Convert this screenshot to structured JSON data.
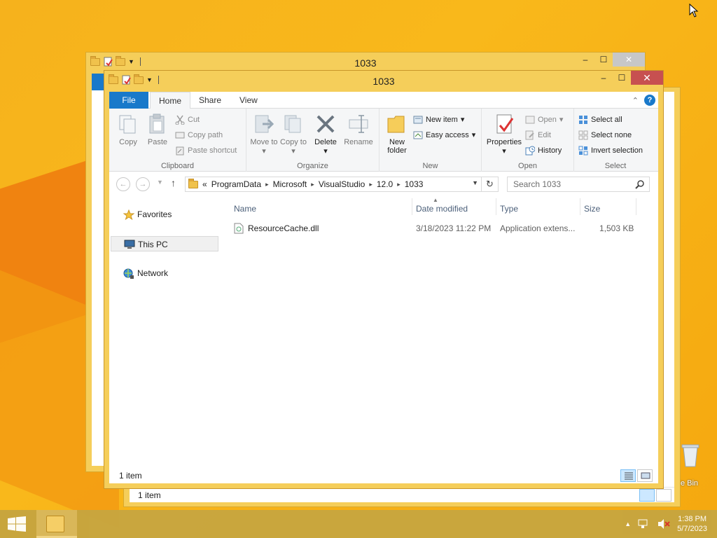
{
  "desktop": {
    "recycle_bin_label": "cle Bin"
  },
  "back_window": {
    "title": "1033"
  },
  "right_window": {
    "status": "1 item"
  },
  "window": {
    "title": "1033",
    "caption": {
      "minimize": "–",
      "maximize": "☐",
      "close": "✕"
    },
    "tabs": {
      "file": "File",
      "home": "Home",
      "share": "Share",
      "view": "View"
    },
    "ribbon": {
      "clipboard": {
        "label": "Clipboard",
        "copy": "Copy",
        "paste": "Paste",
        "cut": "Cut",
        "copy_path": "Copy path",
        "paste_shortcut": "Paste shortcut"
      },
      "organize": {
        "label": "Organize",
        "move_to": "Move to",
        "copy_to": "Copy to",
        "delete": "Delete",
        "rename": "Rename"
      },
      "new": {
        "label": "New",
        "new_folder": "New folder",
        "new_item": "New item",
        "easy_access": "Easy access"
      },
      "open": {
        "label": "Open",
        "properties": "Properties",
        "open": "Open",
        "edit": "Edit",
        "history": "History"
      },
      "select": {
        "label": "Select",
        "select_all": "Select all",
        "select_none": "Select none",
        "invert_selection": "Invert selection"
      }
    },
    "address": {
      "overflow": "«",
      "crumbs": [
        "ProgramData",
        "Microsoft",
        "VisualStudio",
        "12.0",
        "1033"
      ]
    },
    "search": {
      "placeholder": "Search 1033"
    },
    "nav": {
      "favorites": "Favorites",
      "this_pc": "This PC",
      "network": "Network"
    },
    "columns": {
      "name": "Name",
      "date_modified": "Date modified",
      "type": "Type",
      "size": "Size"
    },
    "files": [
      {
        "name": "ResourceCache.dll",
        "date": "3/18/2023 11:22 PM",
        "type": "Application extens...",
        "size": "1,503 KB"
      }
    ],
    "status": "1 item"
  },
  "taskbar": {
    "time": "1:38 PM",
    "date": "5/7/2023"
  },
  "colors": {
    "accent": "#1979ca",
    "close": "#c75050",
    "desktop": "#f6b21c"
  }
}
